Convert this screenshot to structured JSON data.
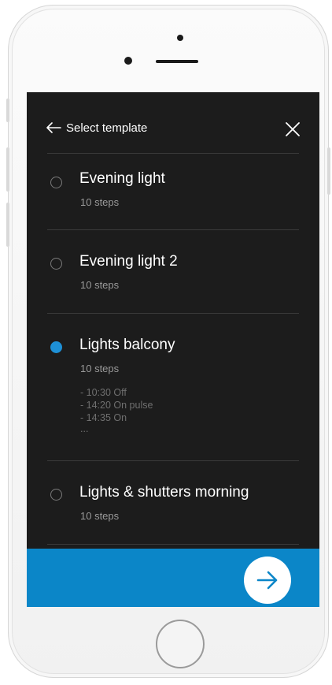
{
  "header": {
    "back_label": "Select template"
  },
  "templates": [
    {
      "title": "Evening light",
      "steps": "10 steps",
      "selected": false
    },
    {
      "title": "Evening light 2",
      "steps": "10 steps",
      "selected": false
    },
    {
      "title": "Lights balcony",
      "steps": "10 steps",
      "selected": true,
      "details": [
        "- 10:30 Off",
        "- 14:20 On pulse",
        "- 14:35 On",
        "..."
      ]
    },
    {
      "title": "Lights & shutters morning",
      "steps": "10 steps",
      "selected": false
    }
  ],
  "colors": {
    "background": "#1c1c1c",
    "accent": "#0b86c8",
    "selected_radio": "#1e90d6"
  },
  "icons": {
    "back": "arrow-left-icon",
    "close": "close-icon",
    "next": "arrow-right-icon"
  }
}
